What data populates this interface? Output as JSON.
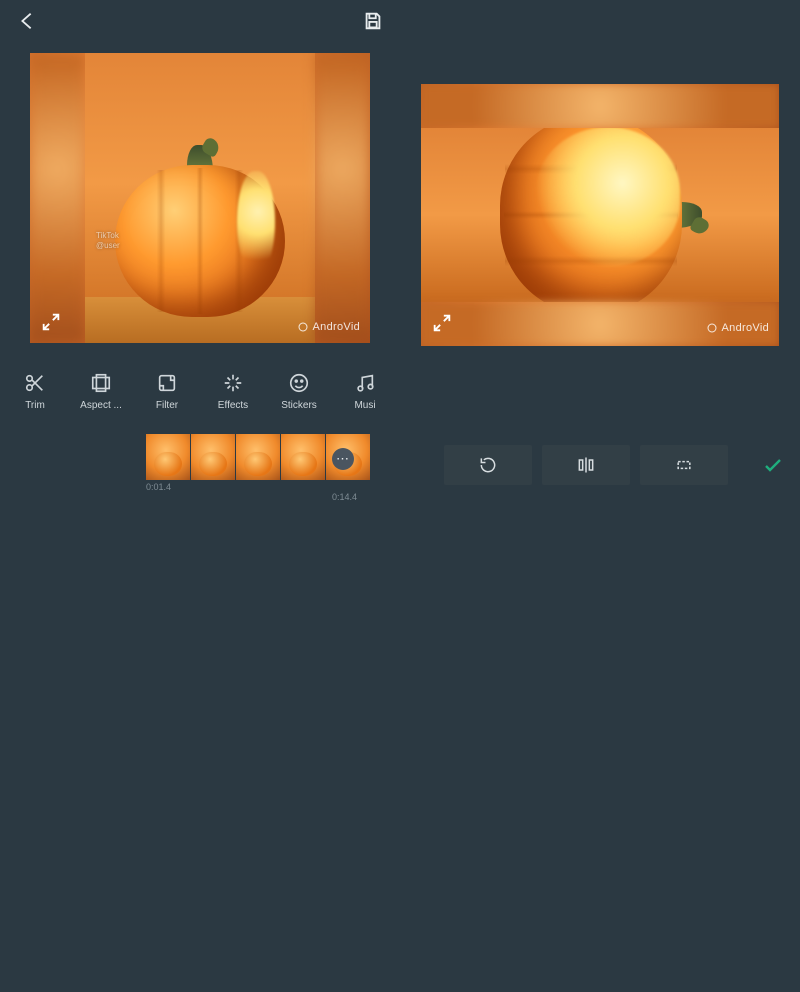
{
  "left": {
    "watermark": "AndroVid",
    "tiktok_line1": "TikTok",
    "tiktok_line2": "@user",
    "tools": [
      {
        "name": "trim",
        "label": "Trim"
      },
      {
        "name": "aspect",
        "label": "Aspect ..."
      },
      {
        "name": "filter",
        "label": "Filter"
      },
      {
        "name": "effects",
        "label": "Effects"
      },
      {
        "name": "stickers",
        "label": "Stickers"
      },
      {
        "name": "music",
        "label": "Musi"
      }
    ],
    "time_start": "0:01.4",
    "time_end": "0:14.4"
  },
  "right": {
    "watermark": "AndroVid"
  }
}
